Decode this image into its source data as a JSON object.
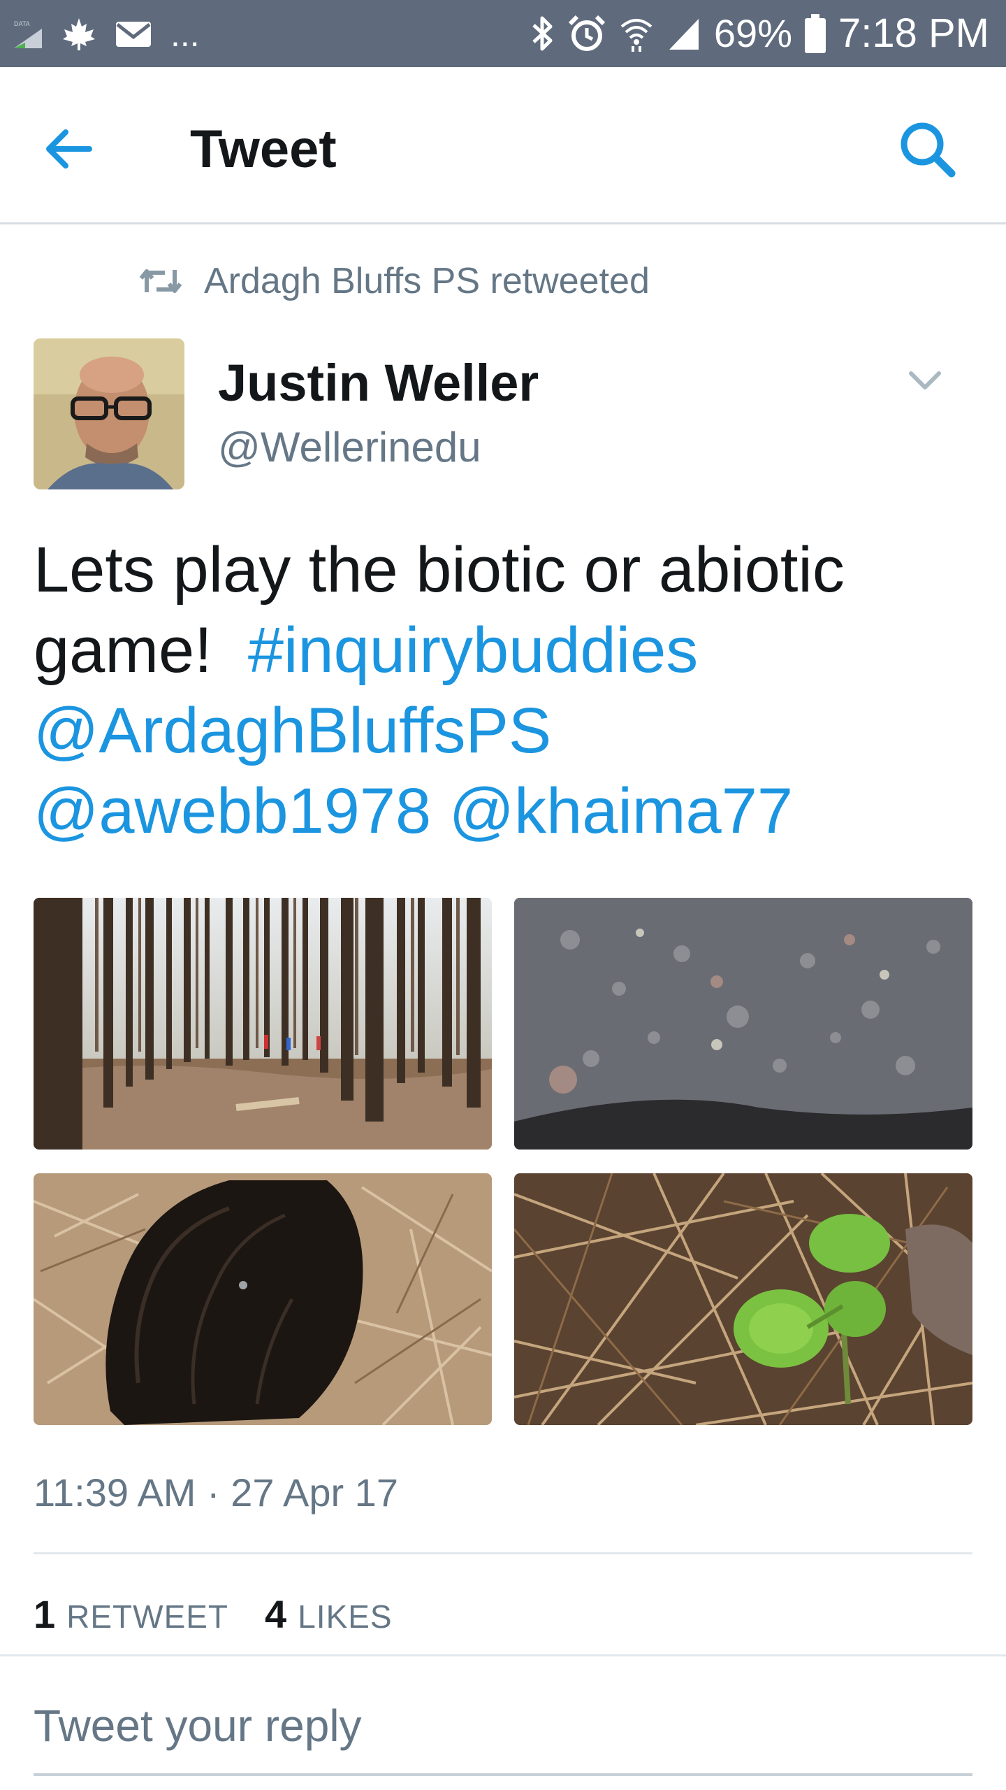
{
  "status_bar": {
    "data_label": "DATA",
    "battery": "69%",
    "time": "7:18 PM",
    "overflow": "...",
    "icons": [
      "data-icon",
      "maple-leaf-icon",
      "mail-icon",
      "bluetooth-icon",
      "alarm-icon",
      "wifi-icon",
      "signal-icon",
      "battery-icon"
    ]
  },
  "header": {
    "title": "Tweet",
    "back_icon": "arrow-left-icon",
    "search_icon": "search-icon"
  },
  "retweet": {
    "text": "Ardagh Bluffs PS retweeted",
    "icon": "retweet-icon"
  },
  "tweet": {
    "author_name": "Justin Weller",
    "author_handle": "@Wellerinedu",
    "text_line1": "Lets play the biotic or abiotic",
    "text_line2": "game!",
    "hashtag": "#inquirybuddies",
    "mention1": "@ArdaghBluffsPS",
    "mention2": "@awebb1978",
    "mention3": "@khaima77",
    "timestamp": "11:39 AM · 27 Apr 17",
    "media": [
      "forest-photo",
      "rock-photo",
      "charred-log-photo",
      "seedling-photo"
    ]
  },
  "stats": {
    "retweets_count": "1",
    "retweets_label": "RETWEET",
    "likes_count": "4",
    "likes_label": "LIKES"
  },
  "reply": {
    "placeholder": "Tweet your reply"
  },
  "colors": {
    "status_bar": "#5f6b7d",
    "link": "#1b95e0",
    "secondary_text": "#657786",
    "primary_text": "#14171a"
  }
}
